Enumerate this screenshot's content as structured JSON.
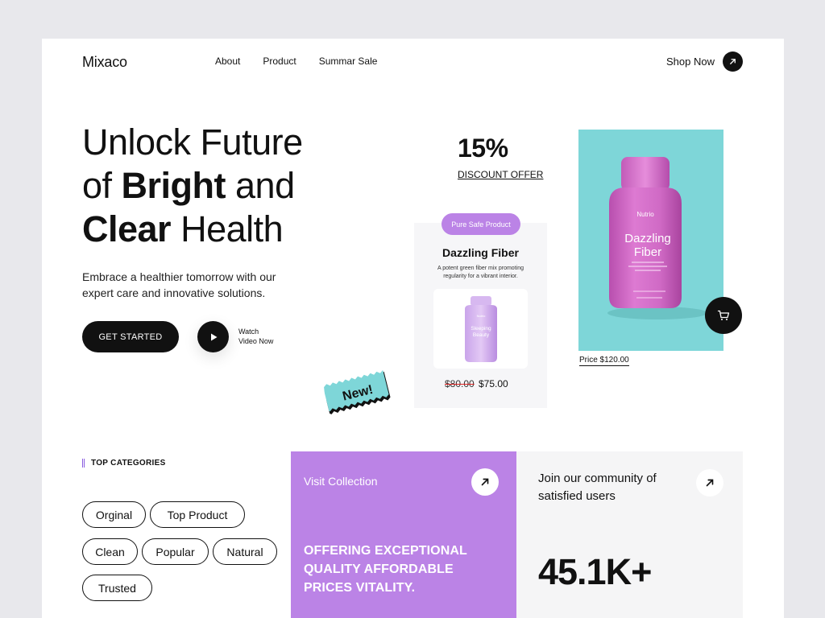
{
  "nav": {
    "logo": "Mixaco",
    "links": [
      "About",
      "Product",
      "Summar Sale"
    ],
    "shop_now": "Shop Now"
  },
  "hero": {
    "line1": "Unlock Future",
    "line2_pre": "of ",
    "line2_bold": "Bright",
    "line2_post": " and",
    "line3_bold": "Clear",
    "line3_post": " Health",
    "subtitle": "Embrace a healthier tomorrow with our expert care and innovative solutions.",
    "cta": "GET STARTED",
    "watch_line1": "Watch",
    "watch_line2": "Video Now"
  },
  "discount": {
    "percent": "15%",
    "label": "DISCOUNT OFFER"
  },
  "product_card": {
    "badge": "Pure Safe Product",
    "title": "Dazzling Fiber",
    "description": "A potent green fiber mix promoting regularity for a vibrant interior.",
    "bottle_brand": "Nutrio",
    "bottle_name": "Sleeping Beauty",
    "old_price": "$80.00",
    "new_price": "$75.00"
  },
  "stamp": {
    "text": "New!"
  },
  "featured": {
    "brand": "Nutrio",
    "name_line1": "Dazzling",
    "name_line2": "Fiber",
    "price": "Price $120.00"
  },
  "categories": {
    "heading": "TOP CATEGORIES",
    "tags": [
      "Orginal",
      "Top Product",
      "Clean",
      "Popular",
      "Natural",
      "Trusted"
    ]
  },
  "collection": {
    "title": "Visit Collection",
    "offer": "OFFERING EXCEPTIONAL QUALITY AFFORDABLE PRICES VITALITY."
  },
  "community": {
    "text": "Join our community of satisfied users",
    "stat": "45.1K+"
  },
  "colors": {
    "purple": "#bb83e6",
    "teal": "#7ed6d8",
    "bottle_pink": "#d36ac6",
    "dark": "#111111"
  }
}
